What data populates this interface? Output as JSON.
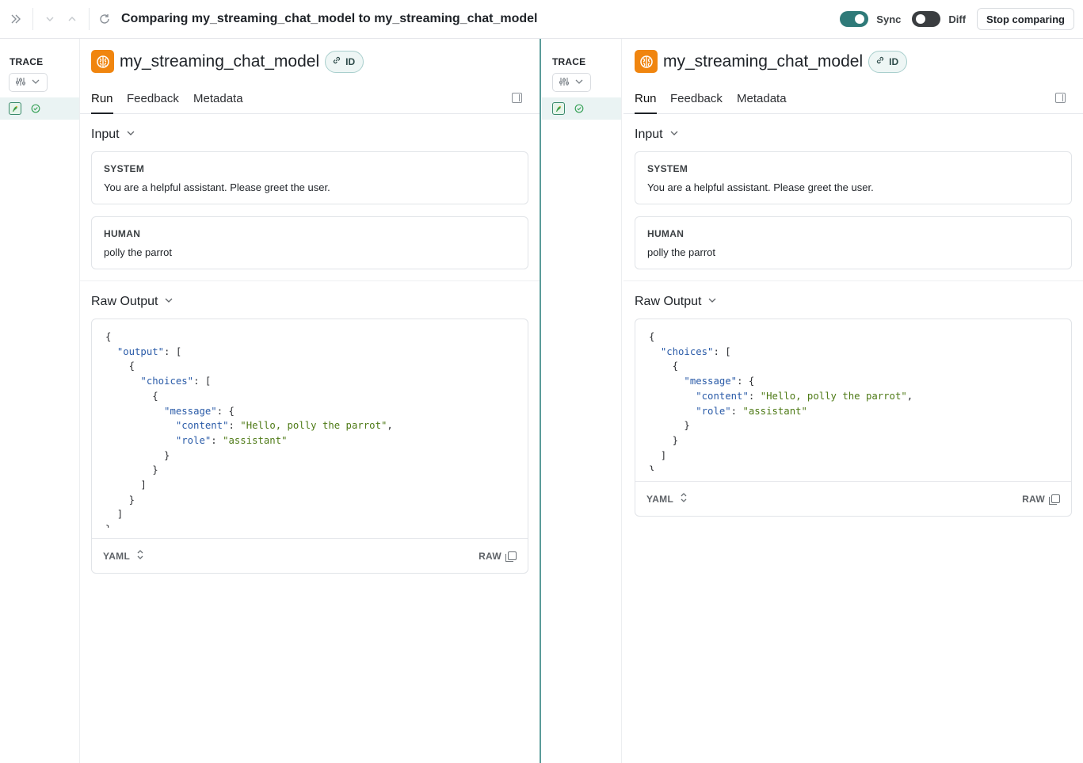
{
  "topbar": {
    "title": "Comparing my_streaming_chat_model to my_streaming_chat_model",
    "sync_label": "Sync",
    "sync_on": true,
    "diff_label": "Diff",
    "diff_on": false,
    "stop_label": "Stop comparing"
  },
  "left": {
    "trace_label": "TRACE",
    "run_name": "my_streaming_chat_model",
    "id_label": "ID",
    "tabs": [
      "Run",
      "Feedback",
      "Metadata"
    ],
    "input_heading": "Input",
    "messages": [
      {
        "role": "SYSTEM",
        "text": "You are a helpful assistant. Please greet the user."
      },
      {
        "role": "HUMAN",
        "text": "polly the parrot"
      }
    ],
    "output_heading": "Raw Output",
    "format_label": "YAML",
    "raw_label": "RAW",
    "code": [
      [
        [
          "p",
          "{"
        ]
      ],
      [
        [
          "p",
          "  "
        ],
        [
          "k",
          "\"output\""
        ],
        [
          "p",
          ": ["
        ]
      ],
      [
        [
          "p",
          "    {"
        ]
      ],
      [
        [
          "p",
          "      "
        ],
        [
          "k",
          "\"choices\""
        ],
        [
          "p",
          ": ["
        ]
      ],
      [
        [
          "p",
          "        {"
        ]
      ],
      [
        [
          "p",
          "          "
        ],
        [
          "k",
          "\"message\""
        ],
        [
          "p",
          ": {"
        ]
      ],
      [
        [
          "p",
          "            "
        ],
        [
          "k",
          "\"content\""
        ],
        [
          "p",
          ": "
        ],
        [
          "s",
          "\"Hello, polly the parrot\""
        ],
        [
          "p",
          ","
        ]
      ],
      [
        [
          "p",
          "            "
        ],
        [
          "k",
          "\"role\""
        ],
        [
          "p",
          ": "
        ],
        [
          "s",
          "\"assistant\""
        ]
      ],
      [
        [
          "p",
          "          }"
        ]
      ],
      [
        [
          "p",
          "        }"
        ]
      ],
      [
        [
          "p",
          "      ]"
        ]
      ],
      [
        [
          "p",
          "    }"
        ]
      ],
      [
        [
          "p",
          "  ]"
        ]
      ],
      [
        [
          "p",
          "}"
        ]
      ]
    ]
  },
  "right": {
    "trace_label": "TRACE",
    "run_name": "my_streaming_chat_model",
    "id_label": "ID",
    "tabs": [
      "Run",
      "Feedback",
      "Metadata"
    ],
    "input_heading": "Input",
    "messages": [
      {
        "role": "SYSTEM",
        "text": "You are a helpful assistant. Please greet the user."
      },
      {
        "role": "HUMAN",
        "text": "polly the parrot"
      }
    ],
    "output_heading": "Raw Output",
    "format_label": "YAML",
    "raw_label": "RAW",
    "code": [
      [
        [
          "p",
          "{"
        ]
      ],
      [
        [
          "p",
          "  "
        ],
        [
          "k",
          "\"choices\""
        ],
        [
          "p",
          ": ["
        ]
      ],
      [
        [
          "p",
          "    {"
        ]
      ],
      [
        [
          "p",
          "      "
        ],
        [
          "k",
          "\"message\""
        ],
        [
          "p",
          ": {"
        ]
      ],
      [
        [
          "p",
          "        "
        ],
        [
          "k",
          "\"content\""
        ],
        [
          "p",
          ": "
        ],
        [
          "s",
          "\"Hello, polly the parrot\""
        ],
        [
          "p",
          ","
        ]
      ],
      [
        [
          "p",
          "        "
        ],
        [
          "k",
          "\"role\""
        ],
        [
          "p",
          ": "
        ],
        [
          "s",
          "\"assistant\""
        ]
      ],
      [
        [
          "p",
          "      }"
        ]
      ],
      [
        [
          "p",
          "    }"
        ]
      ],
      [
        [
          "p",
          "  ]"
        ]
      ],
      [
        [
          "p",
          "}"
        ]
      ]
    ]
  },
  "colors": {
    "accent": "#2f7a79",
    "run_logo": "#f0850f",
    "json_key": "#2a5ba8",
    "json_string": "#4e7a16"
  },
  "icons": [
    "expand-sidebar-icon",
    "chevron-down-icon",
    "chevron-up-icon",
    "refresh-icon",
    "brain-icon",
    "link-icon",
    "filter-icon",
    "parrot-icon",
    "check-circle-icon",
    "panel-icon",
    "sort-icon",
    "copy-icon"
  ]
}
